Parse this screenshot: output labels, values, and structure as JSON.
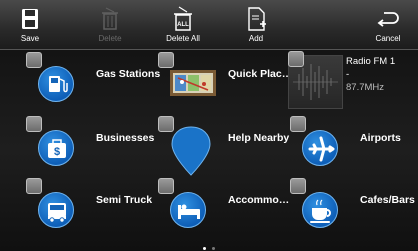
{
  "toolbar": {
    "save": "Save",
    "delete": "Delete",
    "delete_all": "Delete All",
    "delete_all_icon_text": "ALL",
    "add": "Add",
    "cancel": "Cancel"
  },
  "tiles": {
    "gas_stations": "Gas Stations",
    "quick_places": "Quick Plac…",
    "businesses": "Businesses",
    "help_nearby": "Help Nearby",
    "airports": "Airports",
    "semi_truck": "Semi Truck",
    "accommodations": "Accommo…",
    "cafes_bars": "Cafes/Bars"
  },
  "radio": {
    "name": "Radio FM 1",
    "separator": "-",
    "frequency": "87.7MHz"
  },
  "business_icon_symbol": "$",
  "pagination": {
    "pages": 2,
    "current": 1
  },
  "colors": {
    "accent_blue": "#1a73c8",
    "background": "#121212",
    "toolbar": "#333333"
  }
}
